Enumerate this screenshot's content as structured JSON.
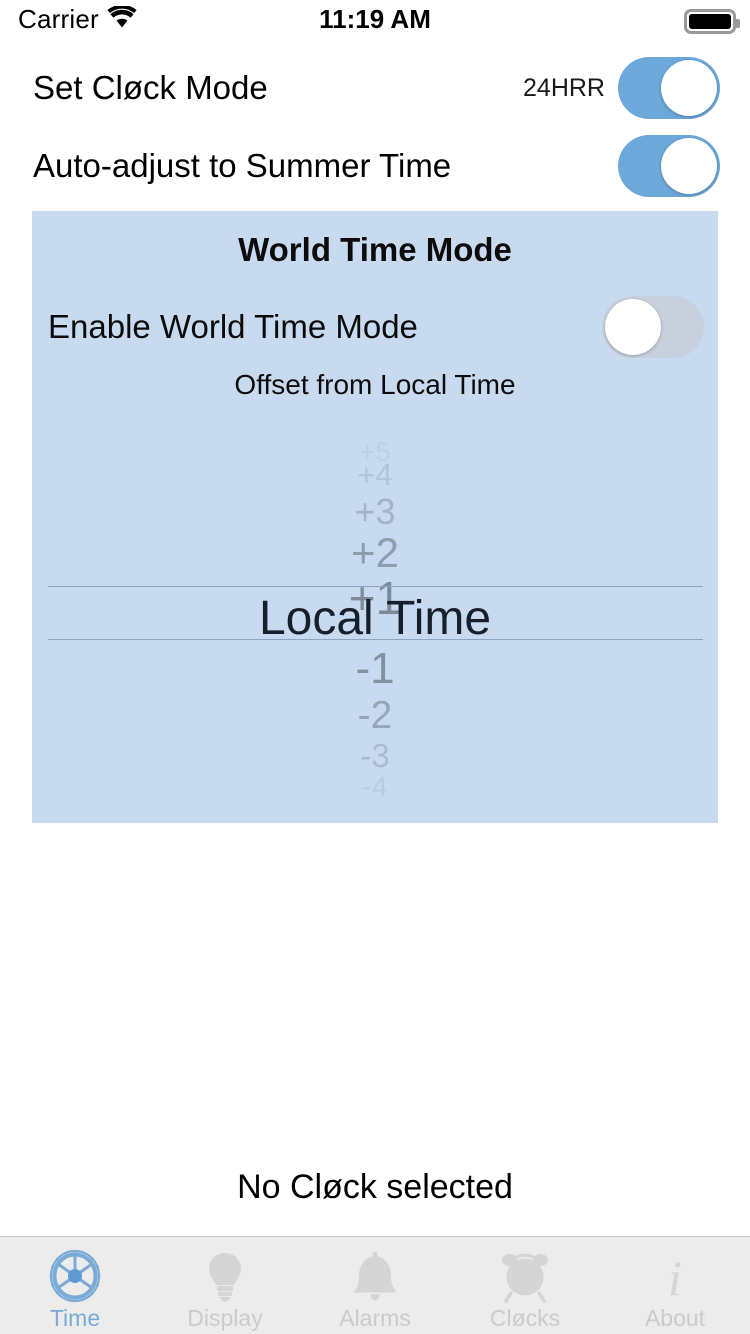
{
  "status_bar": {
    "carrier": "Carrier",
    "wifi_icon": "wifi-icon",
    "time": "11:19 AM",
    "battery_icon": "battery-full-icon"
  },
  "settings": {
    "clock_mode": {
      "label": "Set Cløck Mode",
      "value_label": "24HRR",
      "toggle_state": "on"
    },
    "summer_time": {
      "label": "Auto-adjust to Summer Time",
      "toggle_state": "on"
    }
  },
  "world_time_panel": {
    "title": "World Time Mode",
    "enable_row": {
      "label": "Enable World Time Mode",
      "toggle_state": "off"
    },
    "picker_caption": "Offset from Local Time",
    "picker": {
      "selected": "Local Time",
      "items_above": [
        "+5",
        "+4",
        "+3",
        "+2",
        "+1"
      ],
      "items_below": [
        "-1",
        "-2",
        "-3",
        "-4"
      ]
    },
    "background_color": "#c7daef"
  },
  "footer": {
    "message": "No Cløck selected"
  },
  "tab_bar": {
    "active_color": "#7aabd8",
    "inactive_color": "#cbcbcb",
    "tabs": [
      {
        "label": "Time",
        "icon": "balance-wheel-icon",
        "active": true
      },
      {
        "label": "Display",
        "icon": "lightbulb-icon",
        "active": false
      },
      {
        "label": "Alarms",
        "icon": "bell-icon",
        "active": false
      },
      {
        "label": "Cløcks",
        "icon": "alarm-clock-icon",
        "active": false
      },
      {
        "label": "About",
        "icon": "info-italic-i-icon",
        "active": false
      }
    ]
  },
  "theme": {
    "toggle_on_color": "#6ca8da",
    "toggle_off_color": "#c6d1dd",
    "panel_color": "#c7daef"
  }
}
